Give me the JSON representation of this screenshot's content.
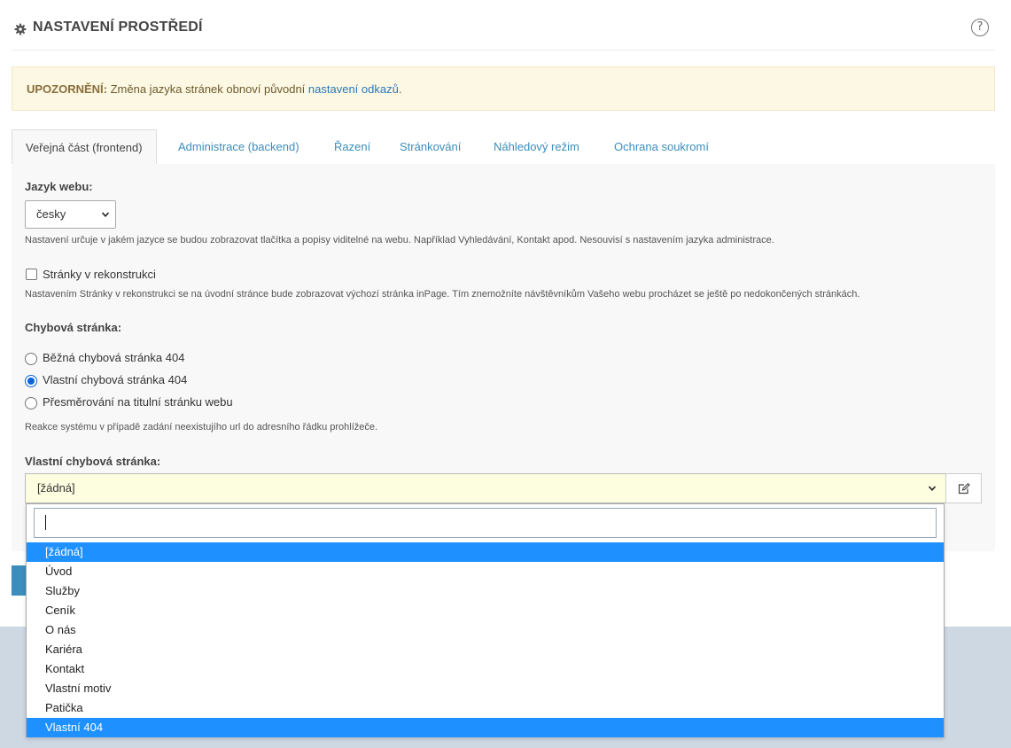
{
  "header": {
    "title": "NASTAVENÍ PROSTŘEDÍ",
    "help_icon": "?"
  },
  "alert": {
    "label": "UPOZORNĚNÍ:",
    "text": " Změna jazyka stránek obnoví původní ",
    "link": "nastavení odkazů",
    "suffix": "."
  },
  "tabs": [
    {
      "label": "Veřejná část (frontend)"
    },
    {
      "label": "Administrace (backend)"
    },
    {
      "label": "Řazení"
    },
    {
      "label": "Stránkování"
    },
    {
      "label": "Náhledový režim"
    },
    {
      "label": "Ochrana soukromí"
    }
  ],
  "language": {
    "label": "Jazyk webu:",
    "value": "česky",
    "help": "Nastavení určuje v jakém jazyce se budou zobrazovat tlačítka a popisy viditelné na webu. Například Vyhledávání, Kontakt apod. Nesouvisí s nastavením jazyka administrace."
  },
  "maintenance": {
    "label": "Stránky v rekonstrukci",
    "checked": false,
    "help": "Nastavením Stránky v rekonstrukci se na úvodní stránce bude zobrazovat výchozí stránka inPage. Tím znemožníte návštěvníkům Vašeho webu procházet se ještě po nedokončených stránkách."
  },
  "error_page": {
    "label": "Chybová stránka:",
    "options": [
      {
        "label": "Běžná chybová stránka 404",
        "checked": false
      },
      {
        "label": "Vlastní chybová stránka 404",
        "checked": true
      },
      {
        "label": "Přesměrování na titulní stránku webu",
        "checked": false
      }
    ],
    "help": "Reakce systému v případě zadání neexistujího url do adresního řádku prohlížeče."
  },
  "custom_error_page": {
    "label": "Vlastní chybová stránka:",
    "value": "[žádná]",
    "search_value": "",
    "options": [
      "[žádná]",
      "Úvod",
      "Služby",
      "Ceník",
      "O nás",
      "Kariéra",
      "Kontakt",
      "Vlastní motiv",
      "Patička",
      "Vlastní 404"
    ],
    "highlighted": [
      "[žádná]",
      "Vlastní 404"
    ]
  },
  "colors": {
    "accent": "#3c8dbc",
    "highlight": "#1e90ff",
    "alert_bg": "#fcf8e3",
    "select_bg": "#fdfde0"
  }
}
